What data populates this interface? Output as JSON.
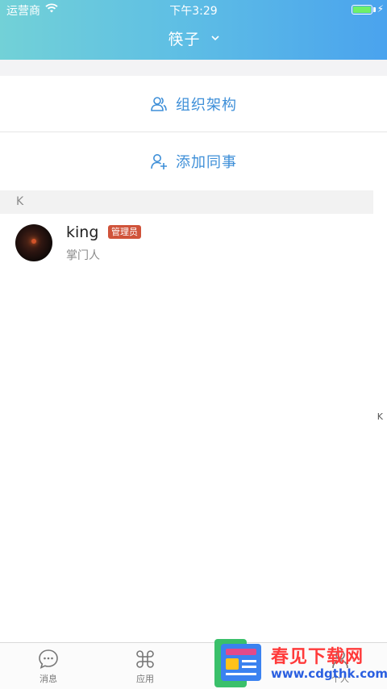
{
  "status_bar": {
    "carrier": "运营商",
    "time": "下午3:29",
    "battery_level": 1.0,
    "charging_symbol": "⚡"
  },
  "header": {
    "title": "筷子",
    "title_icon": "chevron-down-icon",
    "gradient_colors": [
      "#72d1d7",
      "#4aa3ee"
    ]
  },
  "menu": {
    "org_structure": {
      "label": "组织架构",
      "icon": "people-icon"
    },
    "add_colleague": {
      "label": "添加同事",
      "icon": "add-person-icon"
    }
  },
  "sections": [
    {
      "letter": "K",
      "contacts": [
        {
          "name": "king",
          "badge": "管理员",
          "role": "掌门人"
        }
      ]
    }
  ],
  "index_bar": [
    "K"
  ],
  "tabbar": {
    "items": [
      {
        "label": "消息",
        "icon": "chat-bubble-icon"
      },
      {
        "label": "应用",
        "icon": "apps-clover-icon"
      },
      {
        "label": "个人",
        "icon": "person-icon"
      }
    ]
  },
  "watermark": {
    "title": "春见下载网",
    "url": "www.cdgthk.com"
  },
  "colors": {
    "accent": "#3e8fd8",
    "badge": "#d0533a",
    "section_bg": "#f2f2f2"
  }
}
